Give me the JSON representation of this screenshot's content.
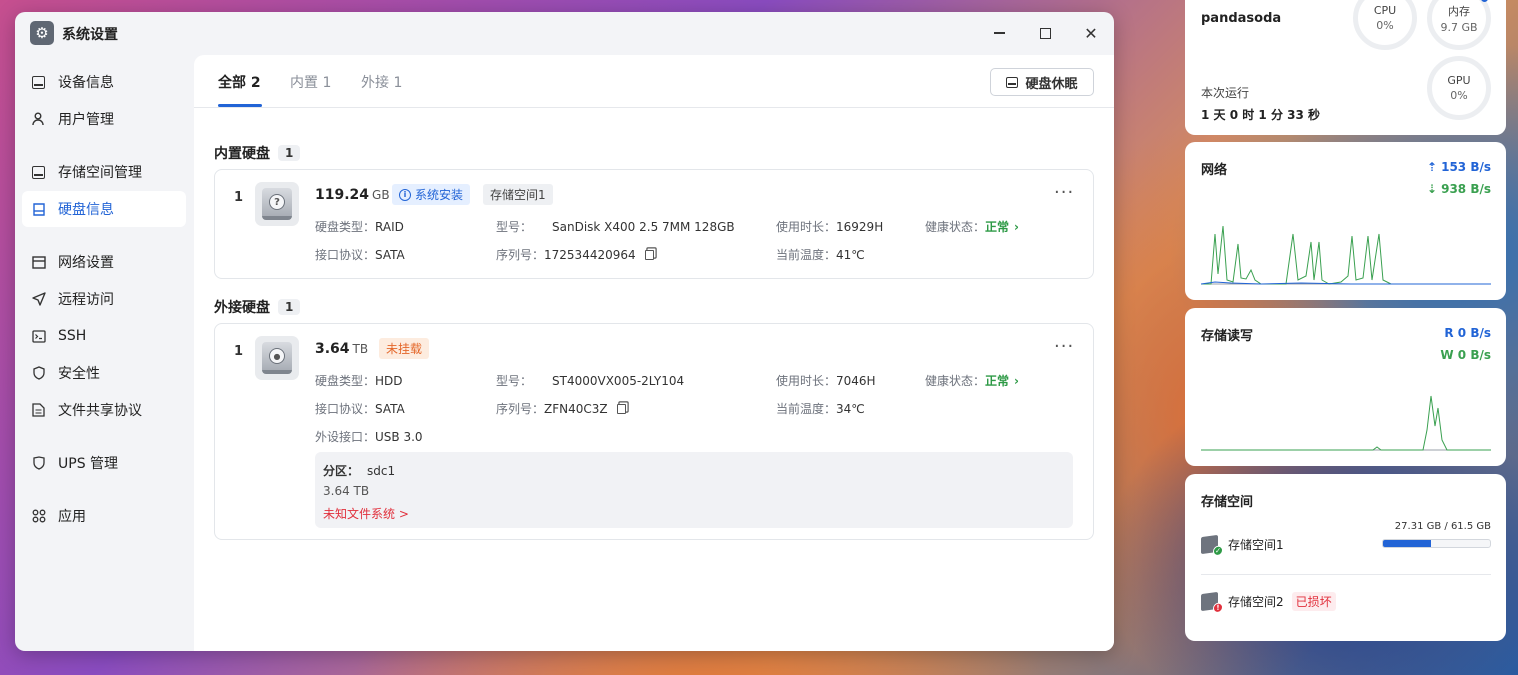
{
  "window": {
    "title": "系统设置",
    "app_icon": "gear-icon"
  },
  "sidebar": {
    "items": [
      {
        "label": "设备信息",
        "icon": "device-icon"
      },
      {
        "label": "用户管理",
        "icon": "user-icon"
      },
      {
        "label": "存储空间管理",
        "icon": "storage-icon"
      },
      {
        "label": "硬盘信息",
        "icon": "disk-icon",
        "active": true
      },
      {
        "label": "网络设置",
        "icon": "network-icon"
      },
      {
        "label": "远程访问",
        "icon": "remote-icon"
      },
      {
        "label": "SSH",
        "icon": "ssh-icon"
      },
      {
        "label": "安全性",
        "icon": "shield-icon"
      },
      {
        "label": "文件共享协议",
        "icon": "file-share-icon"
      },
      {
        "label": "UPS 管理",
        "icon": "ups-icon"
      },
      {
        "label": "应用",
        "icon": "apps-icon"
      }
    ]
  },
  "tabs": [
    {
      "label": "全部 2",
      "active": true
    },
    {
      "label": "内置 1"
    },
    {
      "label": "外接 1"
    }
  ],
  "sleep_button": "硬盘休眠",
  "internal_section": {
    "title": "内置硬盘",
    "count": "1"
  },
  "external_section": {
    "title": "外接硬盘",
    "count": "1"
  },
  "labels": {
    "disk_type": "硬盘类型：",
    "interface": "接口协议：",
    "model": "型号：",
    "serial": "序列号：",
    "usage_time": "使用时长：",
    "temperature": "当前温度：",
    "health": "健康状态：",
    "external_port": "外设接口：",
    "partition": "分区："
  },
  "internal_disk": {
    "index": "1",
    "size": "119.24",
    "size_unit": "GB",
    "tag_system": "系统安装",
    "tag_pool": "存储空间1",
    "disk_type": "RAID",
    "interface": "SATA",
    "model": "SanDisk X400 2.5 7MM 128GB",
    "serial": "172534420964",
    "usage_time": "16929H",
    "temperature": "41℃",
    "health": "正常"
  },
  "external_disk": {
    "index": "1",
    "size": "3.64",
    "size_unit": "TB",
    "tag_status": "未挂载",
    "disk_type": "HDD",
    "interface": "SATA",
    "model": "ST4000VX005-2LY104",
    "serial": "ZFN40C3Z",
    "usage_time": "7046H",
    "temperature": "34℃",
    "health": "正常",
    "external_port": "USB 3.0",
    "partition_name": "sdc1",
    "partition_size": "3.64 TB",
    "partition_fs": "未知文件系统 >"
  },
  "widget_system": {
    "username": "pandasoda",
    "cpu_label": "CPU",
    "cpu_value": "0%",
    "mem_label": "内存",
    "mem_value": "9.7 GB",
    "gpu_label": "GPU",
    "gpu_value": "0%",
    "uptime_label": "本次运行",
    "uptime_value": "1 天 0 时 1 分 33 秒"
  },
  "widget_network": {
    "title": "网络",
    "upload": "153 B/s",
    "download": "938 B/s",
    "up_icon": "upload-arrow-icon",
    "down_icon": "download-arrow-icon"
  },
  "widget_io": {
    "title": "存储读写",
    "read": "R  0 B/s",
    "write": "W  0 B/s"
  },
  "widget_storage": {
    "title": "存储空间",
    "pools": [
      {
        "name": "存储空间1",
        "usage": "27.31 GB / 61.5 GB",
        "used_fraction": 0.444,
        "status": "ok"
      },
      {
        "name": "存储空间2",
        "status_text": "已损坏",
        "status": "broken"
      }
    ]
  },
  "colors": {
    "accent": "#2264d6",
    "healthy": "#2e9a46",
    "warning": "#e4672a",
    "error": "#e1303c"
  }
}
